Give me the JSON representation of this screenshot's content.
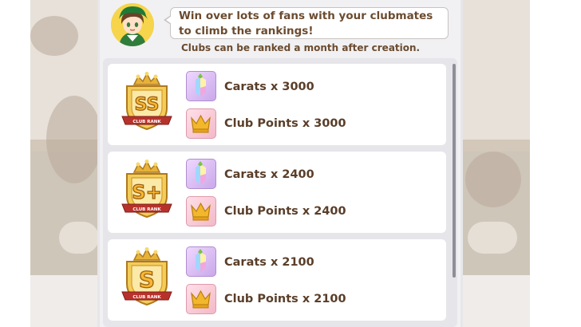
{
  "message": {
    "text": "Win over lots of fans with your clubmates to climb the rankings!",
    "note": "Clubs can be ranked a month after creation."
  },
  "ranks": [
    {
      "rank": "SS",
      "badge_label": "CLUB RANK",
      "carats": "Carats x 3000",
      "club_points": "Club Points x 3000"
    },
    {
      "rank": "S+",
      "badge_label": "CLUB RANK",
      "carats": "Carats x 2400",
      "club_points": "Club Points x 2400"
    },
    {
      "rank": "S",
      "badge_label": "CLUB RANK",
      "carats": "Carats x 2100",
      "club_points": "Club Points x 2100"
    }
  ],
  "colors": {
    "text_brown": "#5a3e29",
    "badge_gold": "#e7b23a",
    "ribbon_red": "#b8322c",
    "carat_bg": "#d9bdf3",
    "crown_bg": "#f6c6d3"
  },
  "icons": [
    "trainer-avatar-icon",
    "carat-icon",
    "crown-icon",
    "club-rank-badge-icon"
  ]
}
